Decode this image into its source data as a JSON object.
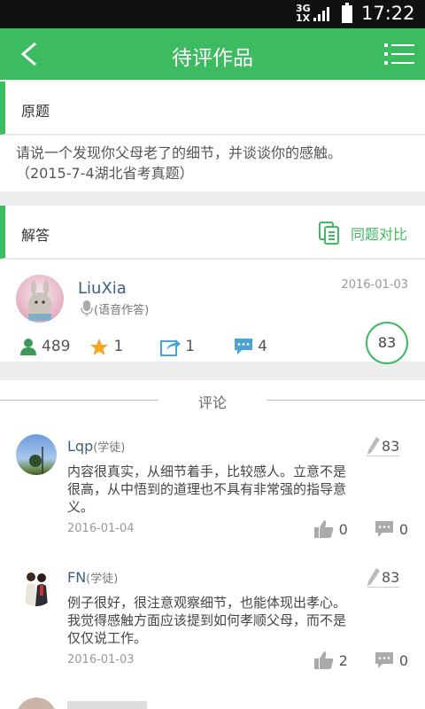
{
  "status_bar": {
    "network_top": "3G",
    "network_bottom": "1X",
    "time": "17:22"
  },
  "app_bar": {
    "title": "待评作品"
  },
  "question_section": {
    "label": "原题",
    "text_line1": "请说一个发现你父母老了的细节，并谈谈你的感触。",
    "text_line2": "（2015-7-4湖北省考真题）"
  },
  "answer_section": {
    "label": "解答",
    "compare_label": "同题对比",
    "user": "LiuXia",
    "answer_type": "(语音作答)",
    "date": "2016-01-03",
    "stats": {
      "views": "489",
      "stars": "1",
      "shares": "1",
      "comments": "4"
    },
    "score": "83"
  },
  "comments_header": "评论",
  "comments": [
    {
      "name": "Lqp",
      "role": "(学徒)",
      "score": "83",
      "lines": [
        "内容很真实，从细节着手，比较感人。立意不是",
        "很高，从中悟到的道理也不具有非常强的指导意",
        "义。"
      ],
      "date": "2016-01-04",
      "likes": "0",
      "replies": "0"
    },
    {
      "name": "FN",
      "role": "(学徒)",
      "score": "83",
      "lines": [
        "例子很好，很注意观察细节，也能体现出孝心。",
        "我觉得感触方面应该提到如何孝顺父母，而不是",
        "仅仅说工作。"
      ],
      "date": "2016-01-03",
      "likes": "2",
      "replies": "0"
    }
  ],
  "colors": {
    "accent": "#3dbb61",
    "name": "#3e5f7e"
  },
  "icons": [
    "back-arrow-icon",
    "list-menu-icon",
    "document-compare-icon",
    "microphone-icon",
    "user-icon",
    "star-icon",
    "share-icon",
    "chat-icon",
    "pencil-icon",
    "thumbs-up-icon",
    "comment-icon"
  ]
}
